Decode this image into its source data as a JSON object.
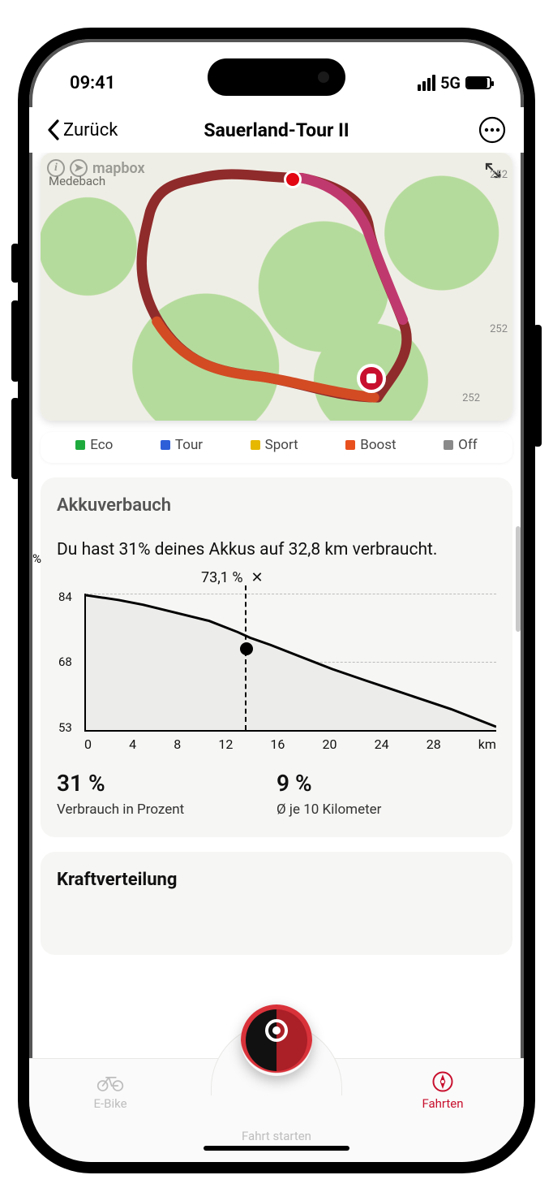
{
  "status": {
    "time": "09:41",
    "network": "5G"
  },
  "nav": {
    "back_label": "Zurück",
    "title": "Sauerland-Tour II"
  },
  "map": {
    "attribution": "mapbox",
    "city": "Medebach",
    "road_label": "252"
  },
  "modes": [
    {
      "label": "Eco",
      "color": "#1faa3e"
    },
    {
      "label": "Tour",
      "color": "#2e5fd9"
    },
    {
      "label": "Sport",
      "color": "#e6b800"
    },
    {
      "label": "Boost",
      "color": "#e8501e"
    },
    {
      "label": "Off",
      "color": "#8a8a8a"
    }
  ],
  "battery_card": {
    "title": "Akkuverbauch",
    "subhead": "Du hast 31% deines Akkus auf 32,8 km verbraucht.",
    "tooltip_value": "73,1 %",
    "y_unit": "%",
    "stats": {
      "left_value": "31 %",
      "left_label": "Verbrauch in Prozent",
      "right_value": "9 %",
      "right_label": "Ø je 10 Kilometer"
    }
  },
  "power_card": {
    "title": "Kraftverteilung"
  },
  "tabs": {
    "ebike": "E-Bike",
    "start": "Fahrt starten",
    "rides": "Fahrten"
  },
  "chart_data": {
    "type": "line",
    "title": "Akkuverbauch",
    "xlabel": "km",
    "ylabel": "%",
    "ylim": [
      53,
      84
    ],
    "y_ticks": [
      53,
      68,
      84
    ],
    "x_ticks": [
      "0",
      "4",
      "8",
      "12",
      "16",
      "20",
      "24",
      "28",
      "km"
    ],
    "cursor": {
      "x_km": 11,
      "y_pct": 73.1
    },
    "series": [
      {
        "name": "battery_pct",
        "x": [
          0,
          2,
          4,
          6,
          8,
          10,
          11,
          12,
          14,
          16,
          18,
          20,
          22,
          24,
          26,
          28,
          30,
          32.8
        ],
        "y": [
          84,
          83,
          82,
          80,
          78,
          75,
          73.1,
          72,
          70,
          68,
          66,
          64,
          62,
          60,
          58,
          56,
          54,
          53
        ]
      }
    ]
  }
}
